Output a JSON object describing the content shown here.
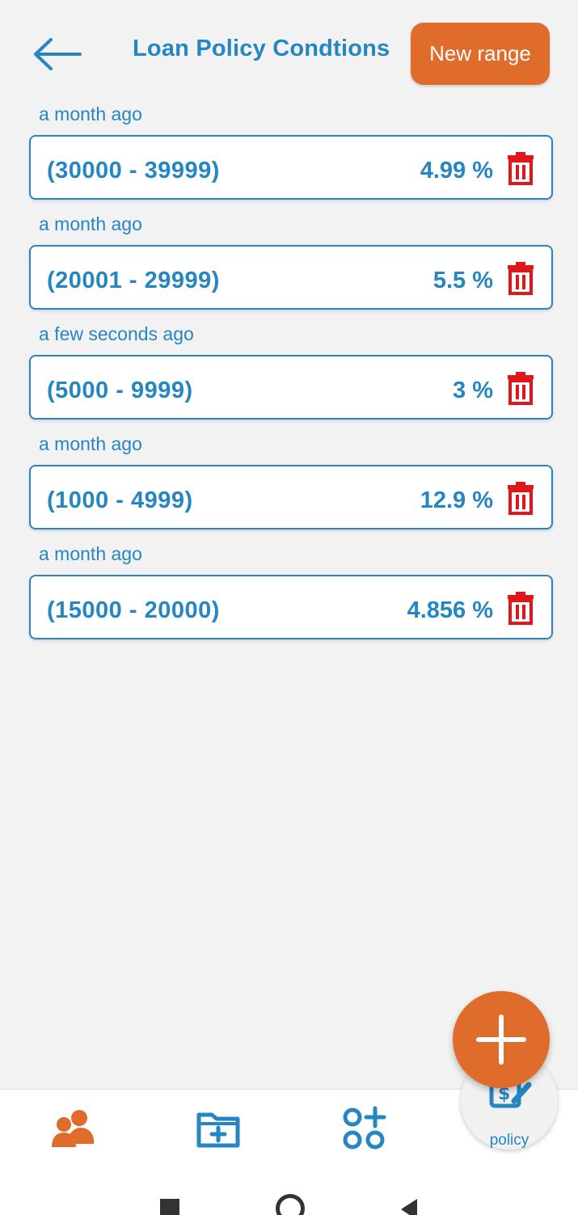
{
  "header": {
    "title": "Loan Policy Condtions",
    "new_range_label": "New range"
  },
  "entries": [
    {
      "time": "a month ago",
      "range": "(30000 - 39999)",
      "rate": "4.99 %"
    },
    {
      "time": "a month ago",
      "range": "(20001 - 29999)",
      "rate": "5.5 %"
    },
    {
      "time": "a few seconds ago",
      "range": "(5000 - 9999)",
      "rate": "3 %"
    },
    {
      "time": "a month ago",
      "range": "(1000 - 4999)",
      "rate": "12.9 %"
    },
    {
      "time": "a month ago",
      "range": "(15000 - 20000)",
      "rate": "4.856 %"
    }
  ],
  "nav": {
    "items": [
      {
        "icon": "users-icon"
      },
      {
        "icon": "folder-add-icon"
      },
      {
        "icon": "apps-add-icon"
      },
      {
        "icon": "policy-icon",
        "label": "policy"
      }
    ],
    "active_label": "policy"
  },
  "colors": {
    "primary": "#2586c2",
    "accent": "#e06c2c",
    "danger": "#e0161b",
    "background": "#f2f2f2"
  },
  "icons": {
    "back": "arrow-left-icon",
    "delete": "trash-icon",
    "fab": "plus-icon"
  }
}
